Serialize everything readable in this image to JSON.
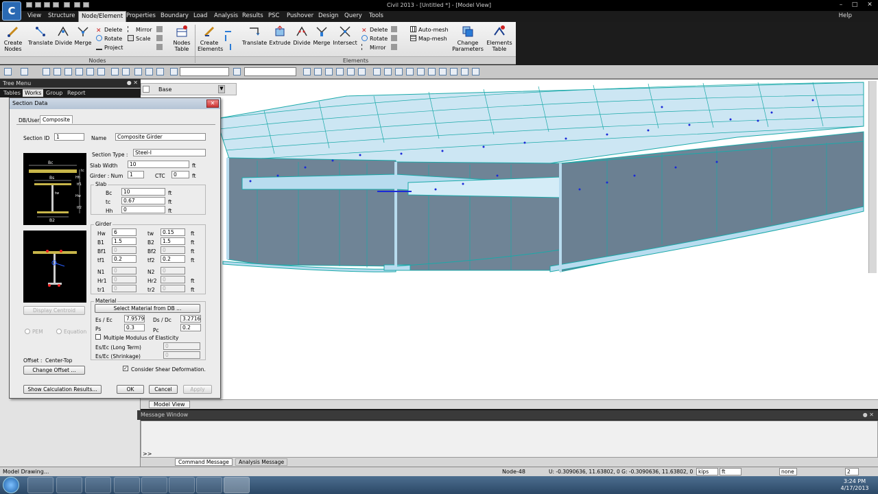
{
  "window": {
    "title": "Civil 2013 - [Untitled *] - [Model View]",
    "logo_text": "C"
  },
  "menu": [
    "View",
    "Structure",
    "Node/Element",
    "Properties",
    "Boundary",
    "Load",
    "Analysis",
    "Results",
    "PSC",
    "Pushover",
    "Design",
    "Query",
    "Tools"
  ],
  "help_menu": "Help",
  "ribbon": {
    "nodes_group": "Nodes",
    "elements_group": "Elements",
    "create_nodes": [
      "Create",
      "Nodes"
    ],
    "translate": "Translate",
    "divide": "Divide",
    "merge": "Merge",
    "delete": "Delete",
    "rotate": "Rotate",
    "project": "Project",
    "mirror": "Mirror",
    "scale": "Scale",
    "nodes_table": [
      "Nodes",
      "Table"
    ],
    "create_elements": [
      "Create",
      "Elements"
    ],
    "e_translate": "Translate",
    "extrude": "Extrude",
    "e_divide": "Divide",
    "e_merge": "Merge",
    "intersect": "Intersect",
    "e_delete": "Delete",
    "e_rotate": "Rotate",
    "e_mirror": "Mirror",
    "auto_mesh": "Auto-mesh",
    "map_mesh": "Map-mesh",
    "change_parameters": [
      "Change",
      "Parameters"
    ],
    "elements_table": [
      "Elements",
      "Table"
    ]
  },
  "tree": {
    "title": "Tree Menu",
    "tabs": [
      "Tables",
      "Works",
      "Group",
      "Report"
    ],
    "active_tab": "Works"
  },
  "view": {
    "plane_combo": "Base",
    "tab_label": "Model View"
  },
  "dialog": {
    "title": "Section Data",
    "tabs": [
      "DB/User",
      "Composite"
    ],
    "section_id_label": "Section ID",
    "section_id": "1",
    "name_label": "Name",
    "name": "Composite Girder",
    "section_type_label": "Section Type :",
    "section_type": "Steel-I",
    "slab_width_label": "Slab Width",
    "slab_width": "10",
    "girder_num_label": "Girder : Num",
    "girder_num": "1",
    "ctc_label": "CTC",
    "ctc": "0",
    "unit": "ft",
    "slab_legend": "Slab",
    "slab": [
      {
        "label": "Bc",
        "value": "10"
      },
      {
        "label": "tc",
        "value": "0.67"
      },
      {
        "label": "Hh",
        "value": "0"
      }
    ],
    "girder_legend": "Girder",
    "girder_left": [
      {
        "label": "Hw",
        "value": "6",
        "enabled": true
      },
      {
        "label": "B1",
        "value": "1.5",
        "enabled": true
      },
      {
        "label": "Bf1",
        "value": "0",
        "enabled": false
      },
      {
        "label": "tf1",
        "value": "0.2",
        "enabled": true
      }
    ],
    "girder_right": [
      {
        "label": "tw",
        "value": "0.15",
        "enabled": true
      },
      {
        "label": "B2",
        "value": "1.5",
        "enabled": true
      },
      {
        "label": "Bf2",
        "value": "0",
        "enabled": false
      },
      {
        "label": "tf2",
        "value": "0.2",
        "enabled": true
      }
    ],
    "stiff_left": [
      {
        "label": "N1",
        "value": "0"
      },
      {
        "label": "Hr1",
        "value": "0"
      },
      {
        "label": "tr1",
        "value": "0"
      }
    ],
    "stiff_right": [
      {
        "label": "N2",
        "value": "0"
      },
      {
        "label": "Hr2",
        "value": "0"
      },
      {
        "label": "tr2",
        "value": "0"
      }
    ],
    "material_legend": "Material",
    "select_material": "Select Material from DB ...",
    "es_ec_label": "Es / Ec",
    "es_ec": "7.95797",
    "ds_dc_label": "Ds / Dc",
    "ds_dc": "3.2716",
    "ps_label": "Ps",
    "ps": "0.3",
    "pc_label": "Pc",
    "pc": "0.2",
    "multiple_modulus": "Multiple Modulus of Elasticity",
    "es_long_label": "Es/Ec (Long Term)",
    "es_long": "0",
    "es_shrink_label": "Es/Ec (Shrinkage)",
    "es_shrink": "0",
    "display_centroid": "Display Centroid",
    "pem": "PEM",
    "equation": "Equation",
    "offset_label": "Offset :",
    "offset_value": "Center-Top",
    "change_offset": "Change Offset ...",
    "consider_shear": "Consider Shear Deformation.",
    "show_calc": "Show Calculation Results...",
    "ok": "OK",
    "cancel": "Cancel",
    "apply": "Apply",
    "diagram_labels": [
      "Bc",
      "Bs",
      "tc",
      "Hh",
      "tf1",
      "tw",
      "Hw",
      "tf2",
      "B2"
    ]
  },
  "message": {
    "title": "Message Window",
    "prompt": ">>",
    "tabs": [
      "Command Message",
      "Analysis Message"
    ]
  },
  "status": {
    "left": "Model Drawing...",
    "node": "Node-48",
    "coords": "U: -0.3090636, 11.63802, 0  G: -0.3090636, 11.63802, 0",
    "force_unit": "kips",
    "length_unit": "ft",
    "none": "none",
    "page": "2"
  },
  "clock": {
    "time": "3:24 PM",
    "date": "4/17/2013"
  },
  "colors": {
    "accent": "#e4e4e4",
    "model_top": "#b8dcef",
    "model_web": "#6f8496",
    "model_line": "#1aa9a9",
    "node_dot": "#1a2ad8"
  }
}
